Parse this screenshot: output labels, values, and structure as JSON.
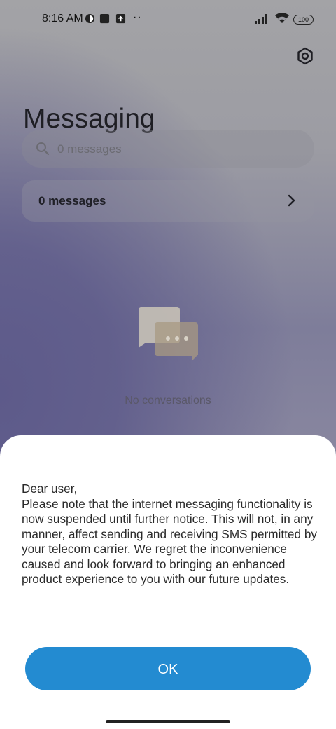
{
  "status_bar": {
    "time": "8:16 AM",
    "dots": "··",
    "battery": "100"
  },
  "header": {
    "title": "Messaging"
  },
  "search": {
    "placeholder": "0 messages"
  },
  "messages_row": {
    "label": "0 messages"
  },
  "empty_state": {
    "text": "No conversations"
  },
  "dialog": {
    "message": "Dear user,\nPlease note that the internet messaging functionality is now suspended until further notice. This will not, in any manner, affect sending and receiving SMS permitted by your telecom carrier. We regret the inconvenience caused and look forward to bringing an enhanced product experience to you with our future updates.",
    "ok_label": "OK"
  },
  "colors": {
    "accent": "#238bd1",
    "sheet": "#ffffff"
  }
}
